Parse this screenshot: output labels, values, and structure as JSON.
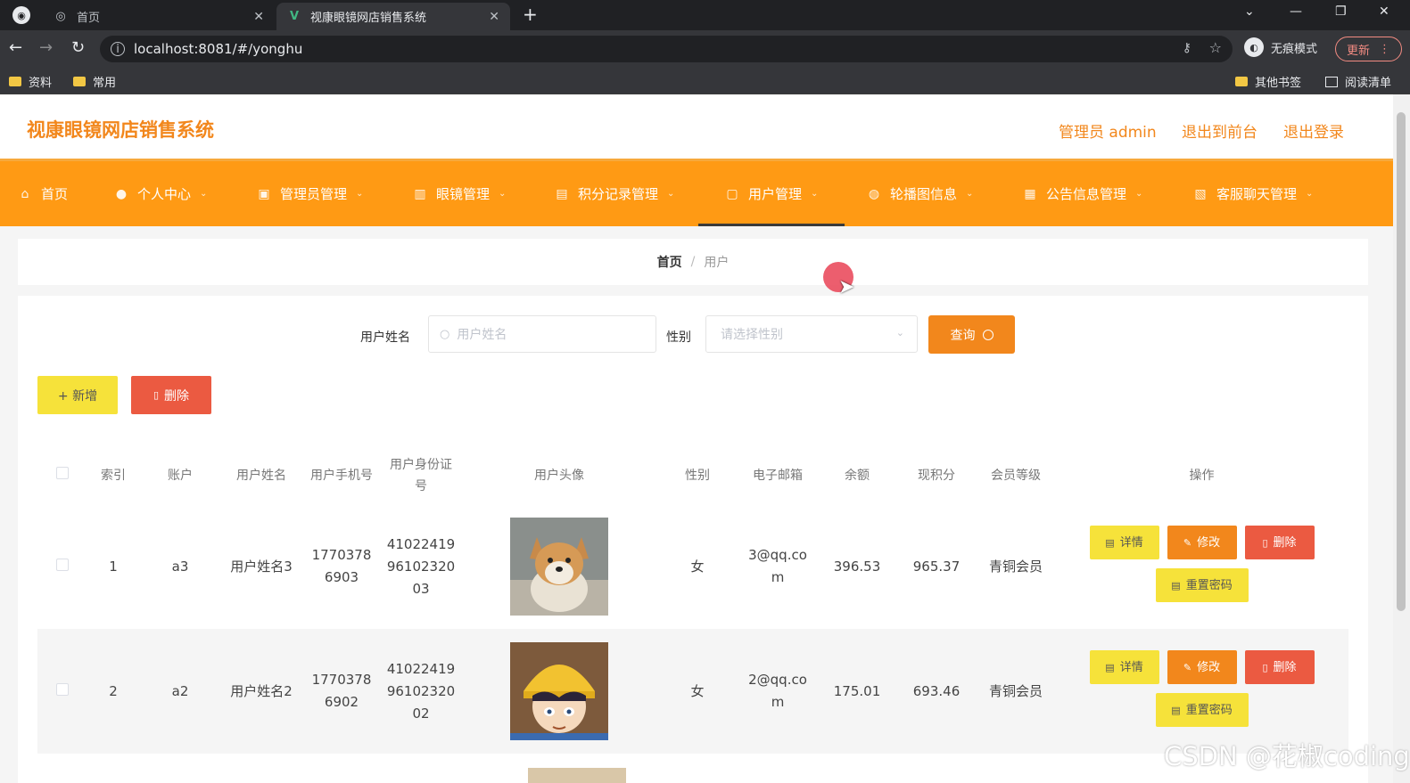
{
  "browser": {
    "tabs": [
      {
        "title": "首页",
        "state": "inactive"
      },
      {
        "title": "视康眼镜网店销售系统",
        "state": "active"
      }
    ],
    "url": "localhost:8081/#/yonghu",
    "incognito_label": "无痕模式",
    "update_label": "更新",
    "bookmarks": [
      "资料",
      "常用"
    ],
    "bookmarks_right": [
      "其他书签",
      "阅读清单"
    ]
  },
  "app": {
    "title": "视康眼镜网店销售系统",
    "header_links": [
      "管理员 admin",
      "退出到前台",
      "退出登录"
    ],
    "accent_color": "#ff9a14"
  },
  "nav": {
    "items": [
      {
        "label": "首页",
        "icon": "home-icon"
      },
      {
        "label": "个人中心",
        "icon": "user-icon"
      },
      {
        "label": "管理员管理",
        "icon": "admin-icon"
      },
      {
        "label": "眼镜管理",
        "icon": "glasses-icon"
      },
      {
        "label": "积分记录管理",
        "icon": "points-icon"
      },
      {
        "label": "用户管理",
        "icon": "users-icon",
        "active": true
      },
      {
        "label": "轮播图信息",
        "icon": "carousel-icon"
      },
      {
        "label": "公告信息管理",
        "icon": "notice-icon"
      },
      {
        "label": "客服聊天管理",
        "icon": "chat-icon"
      }
    ]
  },
  "breadcrumb": {
    "home": "首页",
    "sep": "/",
    "current": "用户"
  },
  "search": {
    "name_label": "用户姓名",
    "name_placeholder": "用户姓名",
    "gender_label": "性别",
    "gender_placeholder": "请选择性别",
    "query_label": "查询"
  },
  "actions": {
    "add_label": "+ 新增",
    "delete_label": "删除"
  },
  "table": {
    "headers": {
      "index": "索引",
      "account": "账户",
      "name": "用户姓名",
      "phone": "用户手机号",
      "idcard": "用户身份证号",
      "avatar": "用户头像",
      "gender": "性别",
      "email": "电子邮箱",
      "balance": "余额",
      "points": "现积分",
      "level": "会员等级",
      "ops": "操作"
    },
    "rows": [
      {
        "index": "1",
        "account": "a3",
        "name": "用户姓名3",
        "phone": "17703786903",
        "idcard": "410224199610232003",
        "gender": "女",
        "email": "3@qq.com",
        "balance": "396.53",
        "points": "965.37",
        "level": "青铜会员",
        "avatar_icon": "shiba-dog-photo"
      },
      {
        "index": "2",
        "account": "a2",
        "name": "用户姓名2",
        "phone": "17703786902",
        "idcard": "410224199610232002",
        "gender": "女",
        "email": "2@qq.com",
        "balance": "175.01",
        "points": "693.46",
        "level": "青铜会员",
        "avatar_icon": "cartoon-boy-photo"
      }
    ],
    "row_ops": {
      "detail": "详情",
      "edit": "修改",
      "remove": "删除",
      "reset": "重置密码"
    }
  },
  "watermark": "CSDN @花椒coding"
}
